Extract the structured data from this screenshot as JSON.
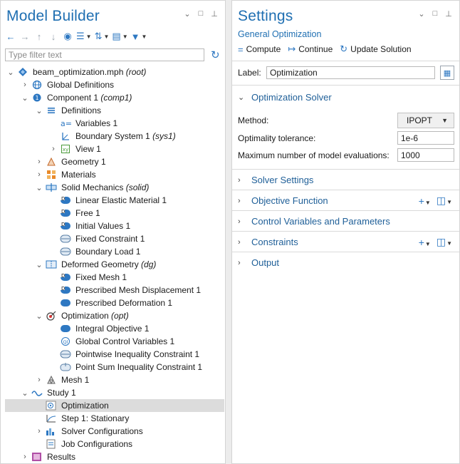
{
  "model_builder": {
    "title": "Model Builder",
    "filter_placeholder": "Type filter text",
    "tree": [
      {
        "label": "beam_optimization.mph",
        "tag": "(root)",
        "depth": 0,
        "twisty": "open",
        "icon": "model-root-icon"
      },
      {
        "label": "Global Definitions",
        "tag": "",
        "depth": 1,
        "twisty": "closed",
        "icon": "globe-icon"
      },
      {
        "label": "Component 1",
        "tag": "(comp1)",
        "depth": 1,
        "twisty": "open",
        "icon": "component-icon"
      },
      {
        "label": "Definitions",
        "tag": "",
        "depth": 2,
        "twisty": "open",
        "icon": "definitions-icon"
      },
      {
        "label": "Variables 1",
        "tag": "",
        "depth": 3,
        "twisty": "none",
        "icon": "variables-icon"
      },
      {
        "label": "Boundary System 1",
        "tag": "(sys1)",
        "depth": 3,
        "twisty": "none",
        "icon": "boundary-system-icon"
      },
      {
        "label": "View 1",
        "tag": "",
        "depth": 3,
        "twisty": "closed",
        "icon": "view-icon"
      },
      {
        "label": "Geometry 1",
        "tag": "",
        "depth": 2,
        "twisty": "closed",
        "icon": "geometry-icon"
      },
      {
        "label": "Materials",
        "tag": "",
        "depth": 2,
        "twisty": "closed",
        "icon": "materials-icon"
      },
      {
        "label": "Solid Mechanics",
        "tag": "(solid)",
        "depth": 2,
        "twisty": "open",
        "icon": "solid-mechanics-icon"
      },
      {
        "label": "Linear Elastic Material 1",
        "tag": "",
        "depth": 3,
        "twisty": "none",
        "icon": "domain-feature-icon"
      },
      {
        "label": "Free 1",
        "tag": "",
        "depth": 3,
        "twisty": "none",
        "icon": "domain-feature-icon"
      },
      {
        "label": "Initial Values 1",
        "tag": "",
        "depth": 3,
        "twisty": "none",
        "icon": "domain-feature-icon"
      },
      {
        "label": "Fixed Constraint 1",
        "tag": "",
        "depth": 3,
        "twisty": "none",
        "icon": "boundary-feature-icon"
      },
      {
        "label": "Boundary Load 1",
        "tag": "",
        "depth": 3,
        "twisty": "none",
        "icon": "boundary-feature-icon"
      },
      {
        "label": "Deformed Geometry",
        "tag": "(dg)",
        "depth": 2,
        "twisty": "open",
        "icon": "deformed-geometry-icon"
      },
      {
        "label": "Fixed Mesh 1",
        "tag": "",
        "depth": 3,
        "twisty": "none",
        "icon": "domain-feature-icon"
      },
      {
        "label": "Prescribed Mesh Displacement 1",
        "tag": "",
        "depth": 3,
        "twisty": "none",
        "icon": "domain-feature-icon"
      },
      {
        "label": "Prescribed Deformation 1",
        "tag": "",
        "depth": 3,
        "twisty": "none",
        "icon": "solid-domain-icon"
      },
      {
        "label": "Optimization",
        "tag": "(opt)",
        "depth": 2,
        "twisty": "open",
        "icon": "optimization-icon"
      },
      {
        "label": "Integral Objective 1",
        "tag": "",
        "depth": 3,
        "twisty": "none",
        "icon": "solid-domain-icon"
      },
      {
        "label": "Global Control Variables 1",
        "tag": "",
        "depth": 3,
        "twisty": "none",
        "icon": "global-control-icon"
      },
      {
        "label": "Pointwise Inequality Constraint 1",
        "tag": "",
        "depth": 3,
        "twisty": "none",
        "icon": "boundary-feature-icon"
      },
      {
        "label": "Point Sum Inequality Constraint 1",
        "tag": "",
        "depth": 3,
        "twisty": "none",
        "icon": "point-feature-icon"
      },
      {
        "label": "Mesh 1",
        "tag": "",
        "depth": 2,
        "twisty": "closed",
        "icon": "mesh-icon"
      },
      {
        "label": "Study 1",
        "tag": "",
        "depth": 1,
        "twisty": "open",
        "icon": "study-icon"
      },
      {
        "label": "Optimization",
        "tag": "",
        "depth": 2,
        "twisty": "none",
        "icon": "study-optimization-icon",
        "selected": true
      },
      {
        "label": "Step 1: Stationary",
        "tag": "",
        "depth": 2,
        "twisty": "none",
        "icon": "stationary-step-icon"
      },
      {
        "label": "Solver Configurations",
        "tag": "",
        "depth": 2,
        "twisty": "closed",
        "icon": "solver-config-icon"
      },
      {
        "label": "Job Configurations",
        "tag": "",
        "depth": 2,
        "twisty": "none",
        "icon": "job-config-icon"
      },
      {
        "label": "Results",
        "tag": "",
        "depth": 1,
        "twisty": "closed",
        "icon": "results-icon"
      }
    ]
  },
  "settings": {
    "title": "Settings",
    "subtitle": "General Optimization",
    "actions": {
      "compute": "Compute",
      "continue": "Continue",
      "update": "Update Solution"
    },
    "label_caption": "Label:",
    "label_value": "Optimization",
    "solver_section": "Optimization Solver",
    "method_caption": "Method:",
    "method_value": "IPOPT",
    "tolerance_caption": "Optimality tolerance:",
    "tolerance_value": "1e-6",
    "max_eval_caption": "Maximum number of model evaluations:",
    "max_eval_value": "1000",
    "sections": {
      "solver_settings": "Solver Settings",
      "objective": "Objective Function",
      "control": "Control Variables and Parameters",
      "constraints": "Constraints",
      "output": "Output"
    }
  },
  "colors": {
    "accent": "#1f6fb2",
    "selection": "#dcdcdc",
    "icon_blue": "#2e78c2"
  }
}
